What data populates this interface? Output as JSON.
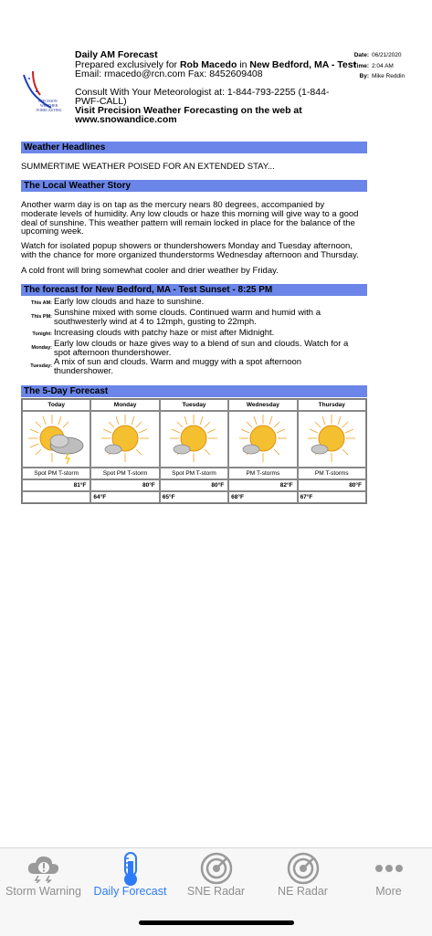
{
  "logo": {
    "text_lines": [
      "PRECISION",
      "WEATHER",
      "FORECASTING"
    ]
  },
  "header": {
    "title": "Daily AM Forecast",
    "prepared_prefix": "Prepared exclusively for ",
    "client": "Rob Macedo",
    "in_text": " in ",
    "location": "New Bedford, MA - Test",
    "contact": "Email: rmacedo@rcn.com Fax: 8452609408",
    "consult_line1": "Consult With Your Meteorologist at: 1-844-793-2255 (1-844-",
    "consult_line2": "PWF-CALL)",
    "visit_line1": "Visit Precision Weather Forecasting on the web at",
    "visit_line2": "www.snowandice.com"
  },
  "meta": {
    "date_label": "Date:",
    "date": "06/21/2020",
    "time_label": "Time:",
    "time": "2:04 AM",
    "by_label": "By:",
    "by": "Mike Reddin"
  },
  "headlines": {
    "title": "Weather Headlines",
    "text": "SUMMERTIME WEATHER POISED FOR AN EXTENDED STAY..."
  },
  "story": {
    "title": "The Local Weather Story",
    "p1": [
      "Another warm day is on tap as the mercury nears 80 degrees, accompanied by",
      "moderate levels of humidity. Any low clouds or haze this morning will give way to a good",
      "deal of sunshine. This weather pattern will remain locked in place for the balance of the",
      "upcoming week."
    ],
    "p2": [
      "Watch for isolated popup showers or thundershowers Monday and Tuesday afternoon,",
      "with the chance for more organized thunderstorms Wednesday afternoon and Thursday."
    ],
    "p3": "A cold front will bring somewhat cooler and drier weather by Friday."
  },
  "periods": {
    "title": "The forecast for New Bedford, MA - Test    Sunset - 8:25 PM",
    "items": [
      {
        "label": "This AM:",
        "lines": [
          "Early low clouds and haze to sunshine."
        ]
      },
      {
        "label": "This PM:",
        "lines": [
          "Sunshine mixed with some clouds. Continued warm and humid with a",
          "southwesterly wind at 4 to 12mph, gusting to 22mph."
        ]
      },
      {
        "label": "Tonight:",
        "lines": [
          "Increasing clouds with patchy haze or mist after Midnight."
        ]
      },
      {
        "label": "Monday:",
        "lines": [
          "Early low clouds or haze gives way to a blend of sun and clouds. Watch for a",
          "spot afternoon thundershower."
        ]
      },
      {
        "label": "Tuesday:",
        "lines": [
          "A mix of sun and clouds. Warm and muggy with a spot afternoon",
          "thundershower."
        ]
      }
    ]
  },
  "five_day": {
    "title": "The 5-Day Forecast",
    "days": [
      {
        "name": "Today",
        "icon": "sun-cloud-storm-icon",
        "cond": "Spot PM T-storm",
        "hi": "81°F",
        "lo": ""
      },
      {
        "name": "Monday",
        "icon": "sun-small-cloud-icon",
        "cond": "Spot PM T-storm",
        "hi": "80°F",
        "lo": "64°F"
      },
      {
        "name": "Tuesday",
        "icon": "sun-small-cloud-icon",
        "cond": "Spot PM T-storm",
        "hi": "80°F",
        "lo": "65°F"
      },
      {
        "name": "Wednesday",
        "icon": "sun-small-cloud-icon",
        "cond": "PM T-storms",
        "hi": "82°F",
        "lo": "68°F"
      },
      {
        "name": "Thursday",
        "icon": "sun-small-cloud-icon",
        "cond": "PM T-storms",
        "hi": "80°F",
        "lo": "67°F"
      }
    ]
  },
  "tabs": [
    {
      "label": "Storm Warning",
      "icon": "storm-cloud-icon",
      "active": false
    },
    {
      "label": "Daily Forecast",
      "icon": "thermometer-icon",
      "active": true
    },
    {
      "label": "SNE Radar",
      "icon": "radar-icon",
      "active": false
    },
    {
      "label": "NE Radar",
      "icon": "radar-icon",
      "active": false
    },
    {
      "label": "More",
      "icon": "more-dots-icon",
      "active": false
    }
  ],
  "colors": {
    "section_bar": "#6b85e8",
    "tab_active": "#2d7bf6",
    "tab_inactive": "#8e8e8e"
  }
}
